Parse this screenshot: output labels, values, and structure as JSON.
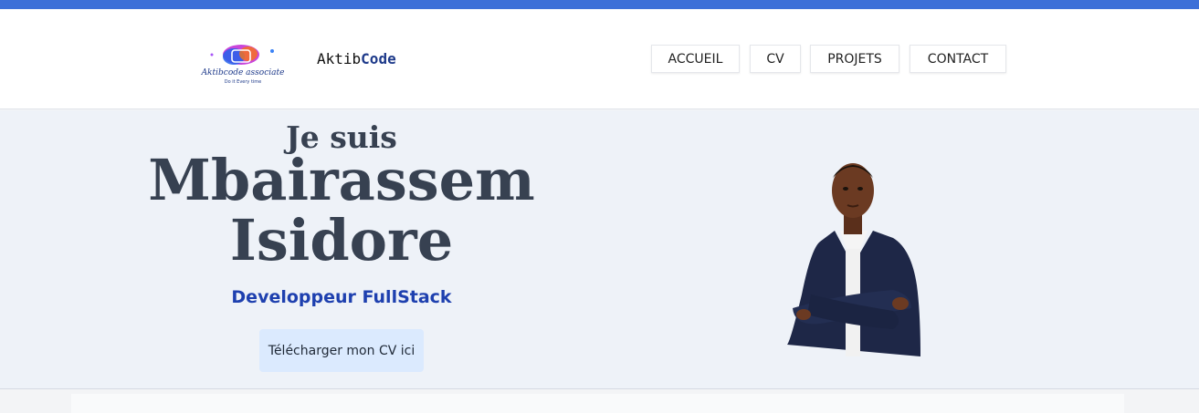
{
  "header": {
    "brand_prefix": "Aktib",
    "brand_suffix": "Code",
    "logo": {
      "name_text": "Aktibcode associate",
      "tagline": "Do it Every time"
    },
    "nav": [
      {
        "label": "ACCUEIL"
      },
      {
        "label": "CV"
      },
      {
        "label": "PROJETS"
      },
      {
        "label": "CONTACT"
      }
    ]
  },
  "hero": {
    "intro": "Je suis",
    "name_line1": "Mbairassem",
    "name_line2": "Isidore",
    "role": "Developpeur FullStack",
    "cv_button": "Télécharger mon CV ici"
  },
  "colors": {
    "top_bar": "#3c6fd8",
    "brand_accent": "#1e3a8a",
    "role_text": "#1e40af",
    "heading_text": "#374151",
    "cv_button_bg": "#dbeafe",
    "hero_bg": "#eef2f8"
  }
}
